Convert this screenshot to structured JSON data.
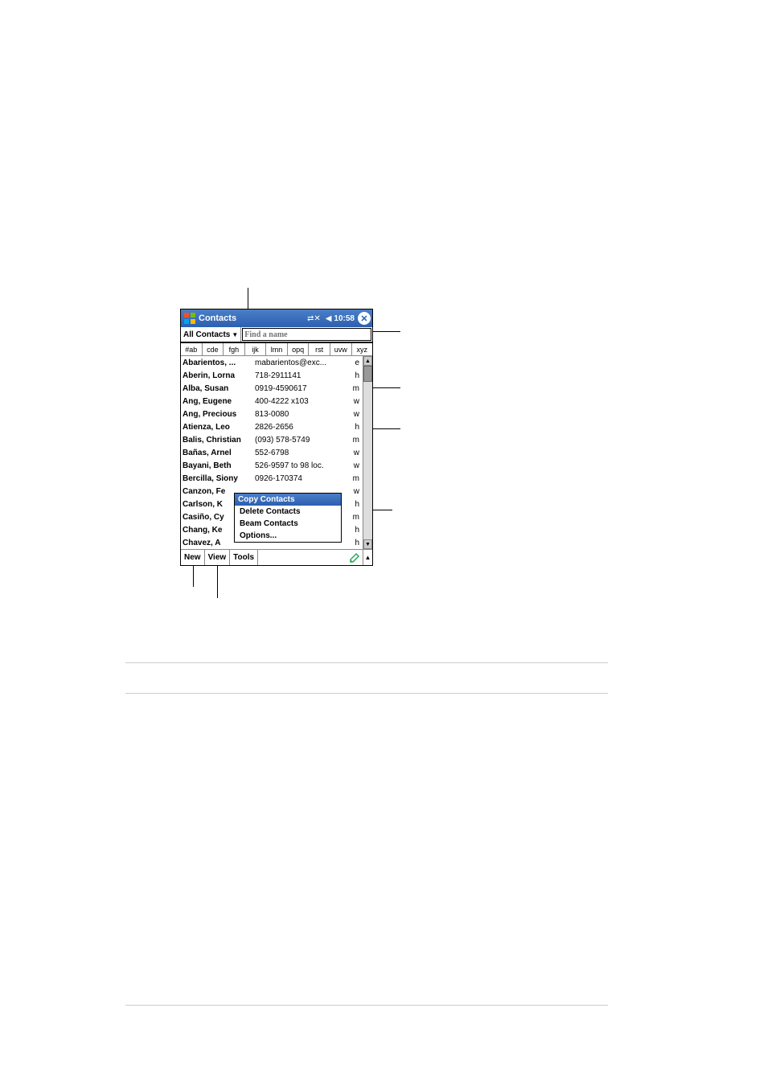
{
  "titlebar": {
    "title": "Contacts",
    "time": "10:58"
  },
  "toolbar": {
    "category": "All Contacts",
    "search_placeholder": "Find a name"
  },
  "alpha_tabs": [
    "#ab",
    "cde",
    "fgh",
    "ijk",
    "lmn",
    "opq",
    "rst",
    "uvw",
    "xyz"
  ],
  "contacts": [
    {
      "name": "Abarientos, ...",
      "detail": "mabarientos@exc...",
      "type": "e"
    },
    {
      "name": "Aberin, Lorna",
      "detail": "718-2911141",
      "type": "h"
    },
    {
      "name": "Alba, Susan",
      "detail": "0919-4590617",
      "type": "m"
    },
    {
      "name": "Ang, Eugene",
      "detail": "400-4222 x103",
      "type": "w"
    },
    {
      "name": "Ang, Precious",
      "detail": "813-0080",
      "type": "w"
    },
    {
      "name": "Atienza, Leo",
      "detail": "2826-2656",
      "type": "h"
    },
    {
      "name": "Balis, Christian",
      "detail": "(093) 578-5749",
      "type": "m"
    },
    {
      "name": "Bañas, Arnel",
      "detail": "552-6798",
      "type": "w"
    },
    {
      "name": "Bayani, Beth",
      "detail": "526-9597 to 98 loc.",
      "type": "w"
    },
    {
      "name": "Bercilla, Siony",
      "detail": "0926-170374",
      "type": "m"
    },
    {
      "name": "Canzon, Fe",
      "detail": "",
      "type": "w"
    },
    {
      "name": "Carlson, K",
      "detail": "",
      "type": "h"
    },
    {
      "name": "Casiño, Cy",
      "detail": "",
      "type": "m"
    },
    {
      "name": "Chang, Ke",
      "detail": "",
      "type": "h"
    },
    {
      "name": "Chavez, A",
      "detail": "",
      "type": "h"
    }
  ],
  "context_menu": {
    "title": "Copy Contacts",
    "items": [
      "Delete Contacts",
      "Beam Contacts",
      "Options..."
    ]
  },
  "bottombar": {
    "new": "New",
    "view": "View",
    "tools": "Tools"
  }
}
